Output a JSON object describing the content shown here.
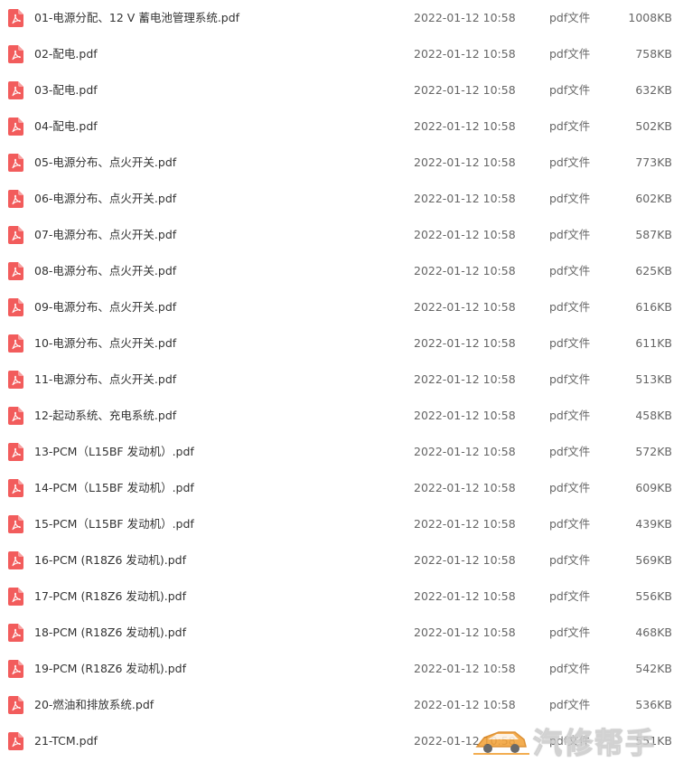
{
  "colors": {
    "pdf_icon": "#f25c5c",
    "text": "#333333",
    "muted": "#666666"
  },
  "files": [
    {
      "name": "01-电源分配、12 V 蓄电池管理系统.pdf",
      "date": "2022-01-12 10:58",
      "type": "pdf文件",
      "size": "1008KB"
    },
    {
      "name": "02-配电.pdf",
      "date": "2022-01-12 10:58",
      "type": "pdf文件",
      "size": "758KB"
    },
    {
      "name": "03-配电.pdf",
      "date": "2022-01-12 10:58",
      "type": "pdf文件",
      "size": "632KB"
    },
    {
      "name": "04-配电.pdf",
      "date": "2022-01-12 10:58",
      "type": "pdf文件",
      "size": "502KB"
    },
    {
      "name": "05-电源分布、点火开关.pdf",
      "date": "2022-01-12 10:58",
      "type": "pdf文件",
      "size": "773KB"
    },
    {
      "name": "06-电源分布、点火开关.pdf",
      "date": "2022-01-12 10:58",
      "type": "pdf文件",
      "size": "602KB"
    },
    {
      "name": "07-电源分布、点火开关.pdf",
      "date": "2022-01-12 10:58",
      "type": "pdf文件",
      "size": "587KB"
    },
    {
      "name": "08-电源分布、点火开关.pdf",
      "date": "2022-01-12 10:58",
      "type": "pdf文件",
      "size": "625KB"
    },
    {
      "name": "09-电源分布、点火开关.pdf",
      "date": "2022-01-12 10:58",
      "type": "pdf文件",
      "size": "616KB"
    },
    {
      "name": "10-电源分布、点火开关.pdf",
      "date": "2022-01-12 10:58",
      "type": "pdf文件",
      "size": "611KB"
    },
    {
      "name": "11-电源分布、点火开关.pdf",
      "date": "2022-01-12 10:58",
      "type": "pdf文件",
      "size": "513KB"
    },
    {
      "name": "12-起动系统、充电系统.pdf",
      "date": "2022-01-12 10:58",
      "type": "pdf文件",
      "size": "458KB"
    },
    {
      "name": "13-PCM（L15BF 发动机）.pdf",
      "date": "2022-01-12 10:58",
      "type": "pdf文件",
      "size": "572KB"
    },
    {
      "name": "14-PCM（L15BF 发动机）.pdf",
      "date": "2022-01-12 10:58",
      "type": "pdf文件",
      "size": "609KB"
    },
    {
      "name": "15-PCM（L15BF 发动机）.pdf",
      "date": "2022-01-12 10:58",
      "type": "pdf文件",
      "size": "439KB"
    },
    {
      "name": "16-PCM (R18Z6 发动机).pdf",
      "date": "2022-01-12 10:58",
      "type": "pdf文件",
      "size": "569KB"
    },
    {
      "name": "17-PCM (R18Z6 发动机).pdf",
      "date": "2022-01-12 10:58",
      "type": "pdf文件",
      "size": "556KB"
    },
    {
      "name": "18-PCM (R18Z6 发动机).pdf",
      "date": "2022-01-12 10:58",
      "type": "pdf文件",
      "size": "468KB"
    },
    {
      "name": "19-PCM (R18Z6 发动机).pdf",
      "date": "2022-01-12 10:58",
      "type": "pdf文件",
      "size": "542KB"
    },
    {
      "name": "20-燃油和排放系统.pdf",
      "date": "2022-01-12 10:58",
      "type": "pdf文件",
      "size": "536KB"
    },
    {
      "name": "21-TCM.pdf",
      "date": "2022-01-12 10:58",
      "type": "pdf文件",
      "size": "551KB"
    }
  ],
  "watermark": {
    "text": "汽修帮手",
    "icon": "car-logo-icon"
  }
}
